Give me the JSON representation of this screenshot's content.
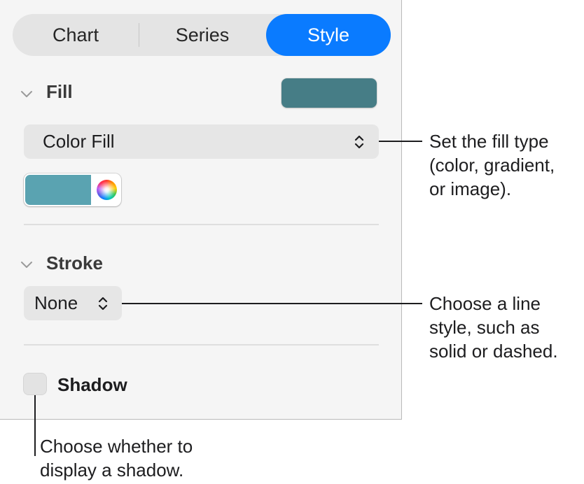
{
  "tabs": [
    {
      "label": "Chart",
      "active": false
    },
    {
      "label": "Series",
      "active": false
    },
    {
      "label": "Style",
      "active": true
    }
  ],
  "fill": {
    "title": "Fill",
    "swatch_color": "#467d86",
    "type_value": "Color Fill",
    "well_color": "#5aa3b1"
  },
  "stroke": {
    "title": "Stroke",
    "style_value": "None"
  },
  "shadow": {
    "label": "Shadow",
    "checked": false
  },
  "callouts": {
    "fill_type": [
      "Set the fill type",
      "(color, gradient,",
      "or image)."
    ],
    "line_style": [
      "Choose a line",
      "style, such as",
      "solid or dashed."
    ],
    "shadow": [
      "Choose whether to",
      "display a shadow."
    ]
  },
  "colors": {
    "accent": "#0a7bff",
    "panel_bg": "#f5f5f5"
  }
}
